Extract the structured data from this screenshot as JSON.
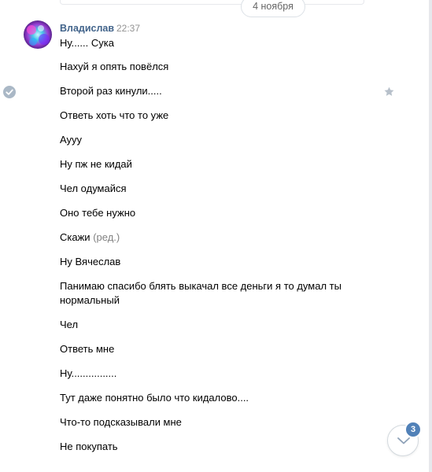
{
  "chat": {
    "date_separator": "4 ноября",
    "sender": {
      "name": "Владислав",
      "time": "22:37"
    },
    "messages": [
      {
        "text": "Ну...... Сука"
      },
      {
        "text": "Нахуй я опять повёлся"
      },
      {
        "text": "Второй раз кинули....."
      },
      {
        "text": "Ответь хоть что то уже"
      },
      {
        "text": "Аууу"
      },
      {
        "text": "Ну пж не кидай"
      },
      {
        "text": "Чел одумайся"
      },
      {
        "text": "Оно тебе нужно"
      },
      {
        "text": "Скажи",
        "edited": "(ред.)"
      },
      {
        "text": "Ну Вячеслав"
      },
      {
        "text": "Панимаю спасибо блять выкачал все деньги я то думал ты нормальный"
      },
      {
        "text": "Чел"
      },
      {
        "text": "Ответь мне"
      },
      {
        "text": "Ну................"
      },
      {
        "text": "Тут даже понятно было что кидалово...."
      },
      {
        "text": "Что-то подсказывали мне"
      },
      {
        "text": "Не покупать"
      }
    ]
  },
  "scroll_down": {
    "unread_count": "3",
    "icon": "chevron-down-icon"
  },
  "colors": {
    "link": "#42648b",
    "muted": "#939393",
    "badge": "#5181b8",
    "border": "#e7e8ec"
  }
}
